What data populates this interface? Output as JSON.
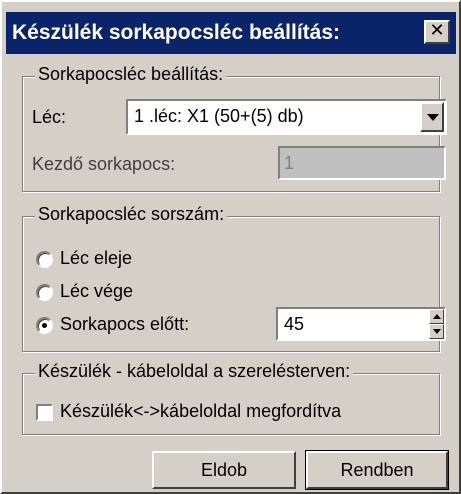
{
  "window": {
    "title": "Készülék sorkapocsléc beállítás:",
    "close_symbol": "✕",
    "close_icon": "close-icon"
  },
  "group_settings": {
    "label": "Sorkapocsléc beállítás:",
    "lec_label": "Léc:",
    "lec_value": "1 .léc:  X1 (50+(5) db)",
    "start_label": "Kezdő sorkapocs:",
    "start_value": "1"
  },
  "group_number": {
    "label": "Sorkapocsléc sorszám:",
    "options": [
      {
        "label": "Léc eleje",
        "checked": false
      },
      {
        "label": "Léc vége",
        "checked": false
      },
      {
        "label": "Sorkapocs előtt:",
        "checked": true
      }
    ],
    "spin_value": "45"
  },
  "group_cable": {
    "label": "Készülék - kábeloldal a szerelésterven:",
    "checkbox_label": "Készülék<->kábeloldal megfordítva",
    "checked": false
  },
  "buttons": {
    "cancel": "Eldob",
    "ok": "Rendben"
  }
}
